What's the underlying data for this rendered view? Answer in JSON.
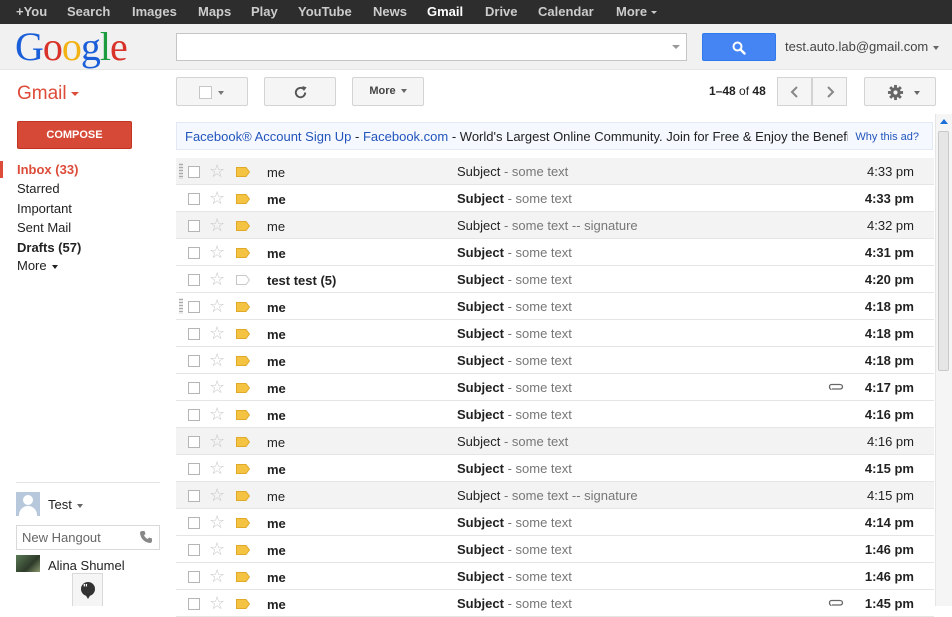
{
  "topbar": {
    "items": [
      "+You",
      "Search",
      "Images",
      "Maps",
      "Play",
      "YouTube",
      "News",
      "Gmail",
      "Drive",
      "Calendar",
      "More"
    ],
    "active": "Gmail"
  },
  "header": {
    "logo": "Google",
    "search_value": "",
    "account": "test.auto.lab@gmail.com"
  },
  "toolbar": {
    "app_label": "Gmail",
    "more_label": "More",
    "range_label": "1–48",
    "of_label": "of",
    "total": "48"
  },
  "sidebar": {
    "compose": "COMPOSE",
    "items": [
      {
        "label": "Inbox (33)",
        "style": "active"
      },
      {
        "label": "Starred",
        "style": "normal"
      },
      {
        "label": "Important",
        "style": "normal"
      },
      {
        "label": "Sent Mail",
        "style": "normal"
      },
      {
        "label": "Drafts (57)",
        "style": "bold"
      },
      {
        "label": "More",
        "style": "more"
      }
    ],
    "user_name": "Test",
    "hangout_placeholder": "New Hangout",
    "contact": "Alina Shumel"
  },
  "ad": {
    "link1": "Facebook® Account Sign Up",
    "sep": " - ",
    "link2": "Facebook.com",
    "text": " - World's Largest Online Community. Join for Free & Enjoy the Benefits",
    "why": "Why this ad?"
  },
  "messages": [
    {
      "sender": "me",
      "subject": "Subject",
      "snippet": " - some text",
      "time": "4:33 pm",
      "unread": false,
      "tag": "yellow",
      "attach": false,
      "handle": true
    },
    {
      "sender": "me",
      "subject": "Subject",
      "snippet": " - some text",
      "time": "4:33 pm",
      "unread": true,
      "tag": "yellow",
      "attach": false,
      "handle": false
    },
    {
      "sender": "me",
      "subject": "Subject",
      "snippet": " - some text -- signature",
      "time": "4:32 pm",
      "unread": false,
      "tag": "yellow",
      "attach": false,
      "handle": false
    },
    {
      "sender": "me",
      "subject": "Subject",
      "snippet": " - some text",
      "time": "4:31 pm",
      "unread": true,
      "tag": "yellow",
      "attach": false,
      "handle": false
    },
    {
      "sender": "test test (5)",
      "subject": "Subject",
      "snippet": " - some text",
      "time": "4:20 pm",
      "unread": true,
      "tag": "empty",
      "attach": false,
      "handle": false
    },
    {
      "sender": "me",
      "subject": "Subject",
      "snippet": " - some text",
      "time": "4:18 pm",
      "unread": true,
      "tag": "yellow",
      "attach": false,
      "handle": true
    },
    {
      "sender": "me",
      "subject": "Subject",
      "snippet": " - some text",
      "time": "4:18 pm",
      "unread": true,
      "tag": "yellow",
      "attach": false,
      "handle": false
    },
    {
      "sender": "me",
      "subject": "Subject",
      "snippet": " - some text",
      "time": "4:18 pm",
      "unread": true,
      "tag": "yellow",
      "attach": false,
      "handle": false
    },
    {
      "sender": "me",
      "subject": "Subject",
      "snippet": " - some text",
      "time": "4:17 pm",
      "unread": true,
      "tag": "yellow",
      "attach": true,
      "handle": false
    },
    {
      "sender": "me",
      "subject": "Subject",
      "snippet": " - some text",
      "time": "4:16 pm",
      "unread": true,
      "tag": "yellow",
      "attach": false,
      "handle": false
    },
    {
      "sender": "me",
      "subject": "Subject",
      "snippet": " - some text",
      "time": "4:16 pm",
      "unread": false,
      "tag": "yellow",
      "attach": false,
      "handle": false
    },
    {
      "sender": "me",
      "subject": "Subject",
      "snippet": " - some text",
      "time": "4:15 pm",
      "unread": true,
      "tag": "yellow",
      "attach": false,
      "handle": false
    },
    {
      "sender": "me",
      "subject": "Subject",
      "snippet": " - some text -- signature",
      "time": "4:15 pm",
      "unread": false,
      "tag": "yellow",
      "attach": false,
      "handle": false
    },
    {
      "sender": "me",
      "subject": "Subject",
      "snippet": " - some text",
      "time": "4:14 pm",
      "unread": true,
      "tag": "yellow",
      "attach": false,
      "handle": false
    },
    {
      "sender": "me",
      "subject": "Subject",
      "snippet": " - some text",
      "time": "1:46 pm",
      "unread": true,
      "tag": "yellow",
      "attach": false,
      "handle": false
    },
    {
      "sender": "me",
      "subject": "Subject",
      "snippet": " - some text",
      "time": "1:46 pm",
      "unread": true,
      "tag": "yellow",
      "attach": false,
      "handle": false
    },
    {
      "sender": "me",
      "subject": "Subject",
      "snippet": " - some text",
      "time": "1:45 pm",
      "unread": true,
      "tag": "yellow",
      "attach": true,
      "handle": false
    }
  ],
  "icons": {
    "search": "search-icon",
    "refresh": "refresh-icon",
    "gear": "gear-icon",
    "star": "star-icon",
    "label": "importance-marker-icon",
    "attachment": "paperclip-icon"
  },
  "colors": {
    "topbar": "#2d2d2d",
    "accent_red": "#dd4b39",
    "compose": "#d64937",
    "search_blue": "#4585f3",
    "tag_yellow": "#f5c342",
    "link": "#2255bb"
  }
}
